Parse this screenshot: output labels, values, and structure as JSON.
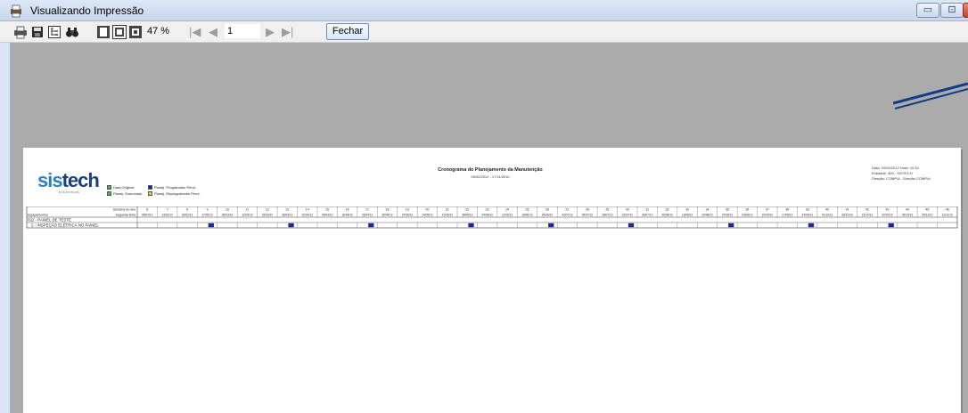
{
  "window": {
    "title": "Visualizando Impressão"
  },
  "toolbar": {
    "zoom_value": "47 %",
    "page_value": "1",
    "close_label": "Fechar",
    "nav": {
      "first": "|◀",
      "prev": "◀",
      "next": "▶",
      "last": "▶|"
    },
    "icons": [
      "printer-icon",
      "save-icon",
      "tree-icon",
      "binoculars-icon",
      "single-page-icon",
      "two-page-icon",
      "multi-page-icon"
    ]
  },
  "report": {
    "logo_part1": "sis",
    "logo_part2": "tech",
    "logo_sub": "sistemas",
    "title": "Cronograma do Planejamento da Manutenção",
    "period": "09/02/2012 - 17/11/2012",
    "legend": [
      {
        "label": "Data Original",
        "color": "#58a85a"
      },
      {
        "label": "Planej. Programado Pend.",
        "color": "#1b2a8c"
      },
      {
        "label": "Planej. Executado",
        "color": "#58a85a"
      },
      {
        "label": "Planej. Reprogramado Pend.",
        "color": "#e0d23a"
      }
    ],
    "info": {
      "line1": "Data:   10/02/2012    Hora:   10:34",
      "line2": "Entidade:   300 - SISTECH",
      "line3": "Direção:      COMP/A - Direção COMP/A"
    },
    "header": {
      "week_label": "Semana do ano",
      "equip_label": "Equipamentos",
      "period_label": "Segunda-feira"
    },
    "weeks": [
      "6",
      "7",
      "8",
      "9",
      "10",
      "11",
      "12",
      "13",
      "14",
      "15",
      "16",
      "17",
      "18",
      "19",
      "20",
      "21",
      "22",
      "23",
      "24",
      "25",
      "26",
      "27",
      "28",
      "29",
      "30",
      "31",
      "32",
      "33",
      "34",
      "35",
      "36",
      "37",
      "38",
      "39",
      "40",
      "41",
      "42",
      "43",
      "44",
      "45",
      "46"
    ],
    "dates": [
      "06/02/12",
      "13/02/12",
      "20/02/12",
      "27/02/12",
      "05/03/12",
      "12/03/12",
      "19/03/12",
      "26/03/12",
      "02/04/12",
      "09/04/12",
      "16/04/12",
      "23/04/12",
      "30/04/12",
      "07/05/12",
      "14/05/12",
      "21/05/12",
      "28/05/12",
      "04/06/12",
      "11/06/12",
      "18/06/12",
      "25/06/12",
      "02/07/12",
      "09/07/12",
      "16/07/12",
      "23/07/12",
      "30/07/12",
      "06/08/12",
      "13/08/12",
      "20/08/12",
      "27/08/12",
      "03/09/12",
      "10/09/12",
      "17/09/12",
      "24/09/12",
      "01/10/12",
      "08/10/12",
      "15/10/12",
      "22/10/12",
      "29/10/12",
      "05/11/12",
      "12/11/12"
    ],
    "group_label": "022 - PAINEL DE TESTE",
    "task_label": "2 - INSPEÇÃO ELÉTRICA NO PAINEL",
    "marked_weeks": [
      "9",
      "13",
      "17",
      "22",
      "26",
      "30",
      "35",
      "39",
      "43"
    ],
    "mark_color": "#1b2a8c"
  }
}
